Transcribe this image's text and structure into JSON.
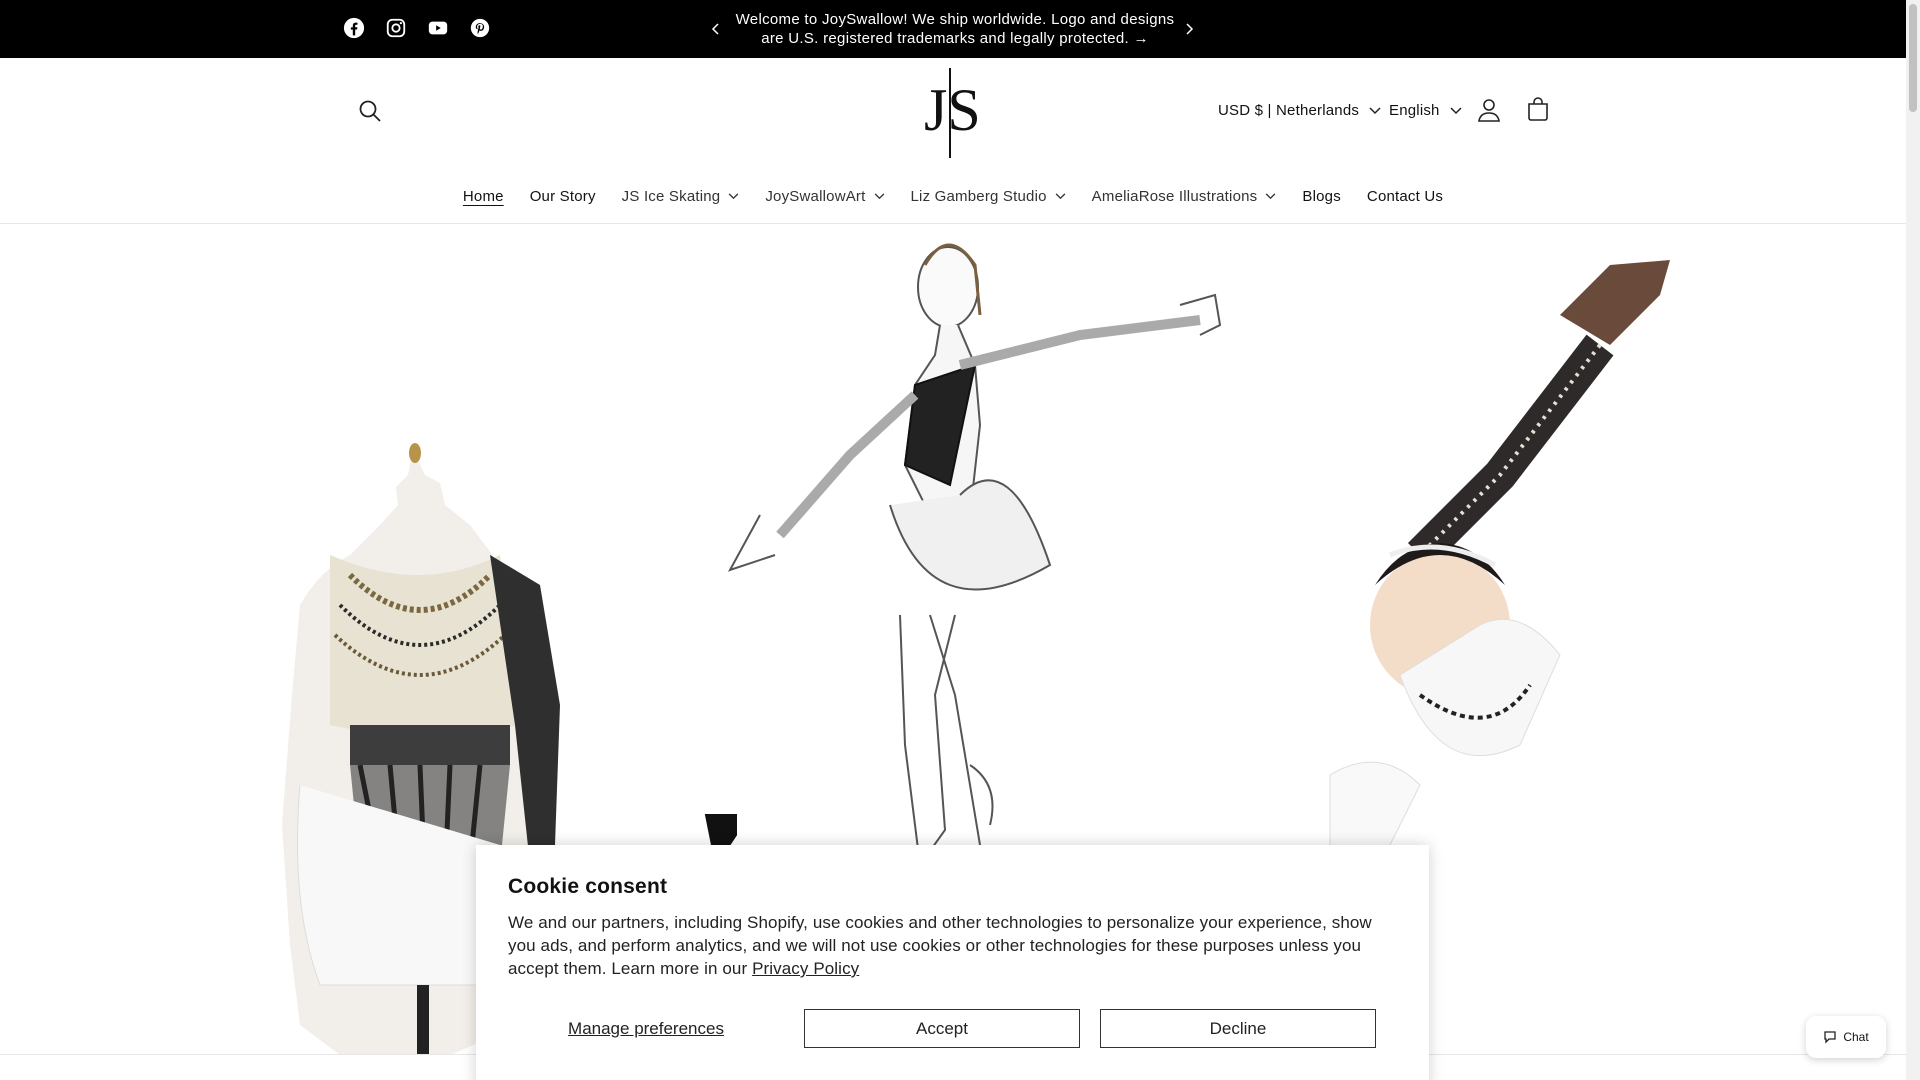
{
  "announcement": {
    "message": "Welcome to JoySwallow! We ship worldwide. Logo and designs are U.S. registered trademarks and legally protected.",
    "arrow": "→",
    "socials": [
      "facebook-icon",
      "instagram-icon",
      "youtube-icon",
      "pinterest-icon"
    ]
  },
  "header": {
    "logo_text": "JS",
    "currency": "USD $ | Netherlands",
    "language": "English"
  },
  "nav": [
    {
      "label": "Home",
      "dropdown": false,
      "active": true
    },
    {
      "label": "Our Story",
      "dropdown": false
    },
    {
      "label": "JS Ice Skating",
      "dropdown": true
    },
    {
      "label": "JoySwallowArt",
      "dropdown": true
    },
    {
      "label": "Liz Gamberg Studio",
      "dropdown": true
    },
    {
      "label": "AmeliaRose Illustrations",
      "dropdown": true
    },
    {
      "label": "Blogs",
      "dropdown": false
    },
    {
      "label": "Contact Us",
      "dropdown": false
    }
  ],
  "cookie": {
    "title": "Cookie consent",
    "body": "We and our partners, including Shopify, use cookies and other technologies to personalize your experience, show you ads, and perform analytics, and we will not use cookies or other technologies for these purposes unless you accept them. Learn more in our ",
    "link": "Privacy Policy",
    "manage": "Manage preferences",
    "accept": "Accept",
    "decline": "Decline"
  },
  "chat": {
    "label": "Chat"
  },
  "colors": {
    "bar": "#000000",
    "text": "#121212",
    "border": "#e6e6e6"
  }
}
